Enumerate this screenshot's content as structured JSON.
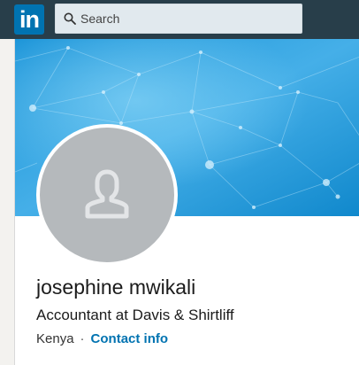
{
  "header": {
    "logo_text": "in",
    "search": {
      "placeholder": "Search",
      "value": ""
    }
  },
  "profile": {
    "name": "josephine mwikali",
    "headline": "Accountant at Davis & Shirtliff",
    "location": "Kenya",
    "separator": "·",
    "contact_label": "Contact info"
  },
  "colors": {
    "topbar": "#283e4a",
    "logo": "#0073b1",
    "banner_light": "#4fb3e6",
    "banner_dark": "#0a7fc0",
    "avatar_bg": "#b5b9bc",
    "link": "#0073b1"
  },
  "icons": {
    "logo": "linkedin-logo",
    "search": "search-icon",
    "avatar": "person-icon"
  }
}
